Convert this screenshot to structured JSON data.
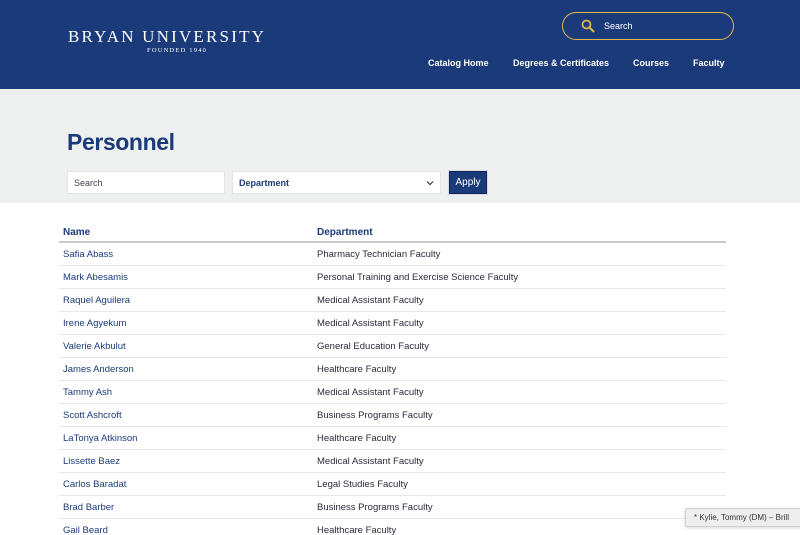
{
  "header": {
    "logo_name": "BRYAN UNIVERSITY",
    "logo_sub": "FOUNDED 1940",
    "search_placeholder": "Search",
    "search_icon": "search-icon",
    "nav": [
      {
        "label": "Catalog Home"
      },
      {
        "label": "Degrees & Certificates"
      },
      {
        "label": "Courses"
      },
      {
        "label": "Faculty"
      }
    ]
  },
  "colors": {
    "primary": "#1b3a7a",
    "accent": "#e0b64a",
    "band": "#eeefef"
  },
  "page": {
    "title": "Personnel"
  },
  "filters": {
    "search_placeholder": "Search",
    "department_selected": "Department",
    "apply_label": "Apply"
  },
  "table": {
    "columns": [
      "Name",
      "Department"
    ],
    "rows": [
      {
        "name": "Safia Abass",
        "department": "Pharmacy Technician Faculty"
      },
      {
        "name": "Mark Abesamis",
        "department": "Personal Training and Exercise Science Faculty"
      },
      {
        "name": "Raquel Aguilera",
        "department": "Medical Assistant Faculty"
      },
      {
        "name": "Irene Agyekum",
        "department": "Medical Assistant Faculty"
      },
      {
        "name": "Valerie Akbulut",
        "department": "General Education Faculty"
      },
      {
        "name": "James Anderson",
        "department": "Healthcare Faculty"
      },
      {
        "name": "Tammy Ash",
        "department": "Medical Assistant Faculty"
      },
      {
        "name": "Scott Ashcroft",
        "department": "Business Programs Faculty"
      },
      {
        "name": "LaTonya Atkinson",
        "department": "Healthcare Faculty"
      },
      {
        "name": "Lissette Baez",
        "department": "Medical Assistant Faculty"
      },
      {
        "name": "Carlos Baradat",
        "department": "Legal Studies Faculty"
      },
      {
        "name": "Brad Barber",
        "department": "Business Programs Faculty"
      },
      {
        "name": "Gail Beard",
        "department": "Healthcare Faculty"
      }
    ]
  },
  "toast": {
    "text": "* Kylie, Tommy (DM) – Brill"
  }
}
